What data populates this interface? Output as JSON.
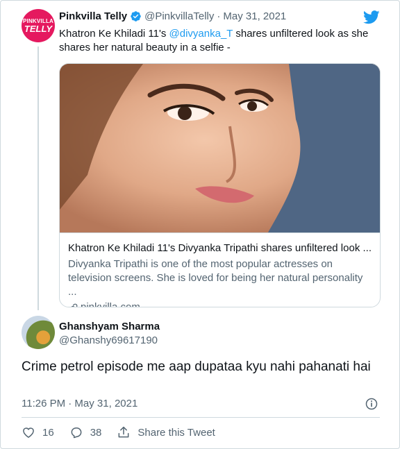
{
  "quoted_tweet": {
    "avatar": {
      "line1": "PINKVILLA",
      "line2": "TELLY"
    },
    "display_name": "Pinkvilla Telly",
    "handle": "@PinkvillaTelly",
    "separator": "·",
    "date": "May 31, 2021",
    "text_before": "Khatron Ke Khiladi 11's ",
    "mention": "@divyanka_T",
    "text_after": " shares unfiltered look as she shares her natural beauty in a selfie -",
    "card": {
      "title": "Khatron Ke Khiladi 11's Divyanka Tripathi shares unfiltered look ...",
      "description": "Divyanka Tripathi is one of the most popular actresses on television screens. She is loved for being her natural personality ...",
      "domain": "pinkvilla.com"
    }
  },
  "reply_tweet": {
    "display_name": "Ghanshyam Sharma",
    "handle": "@Ghanshy69617190",
    "text": "Crime petrol episode me aap dupataa kyu nahi pahanati hai",
    "timestamp": "11:26 PM · May 31, 2021",
    "actions": {
      "likes": "16",
      "replies": "38",
      "share_label": "Share this Tweet"
    }
  },
  "colors": {
    "accent_blue": "#1d9bf0",
    "brand_pink": "#e5195f",
    "text_primary": "#0f1419",
    "text_secondary": "#536471",
    "border": "#cfd9de"
  },
  "icons": [
    "verified-icon",
    "twitter-bird-icon",
    "link-icon",
    "info-icon",
    "heart-icon",
    "reply-icon",
    "share-icon"
  ]
}
